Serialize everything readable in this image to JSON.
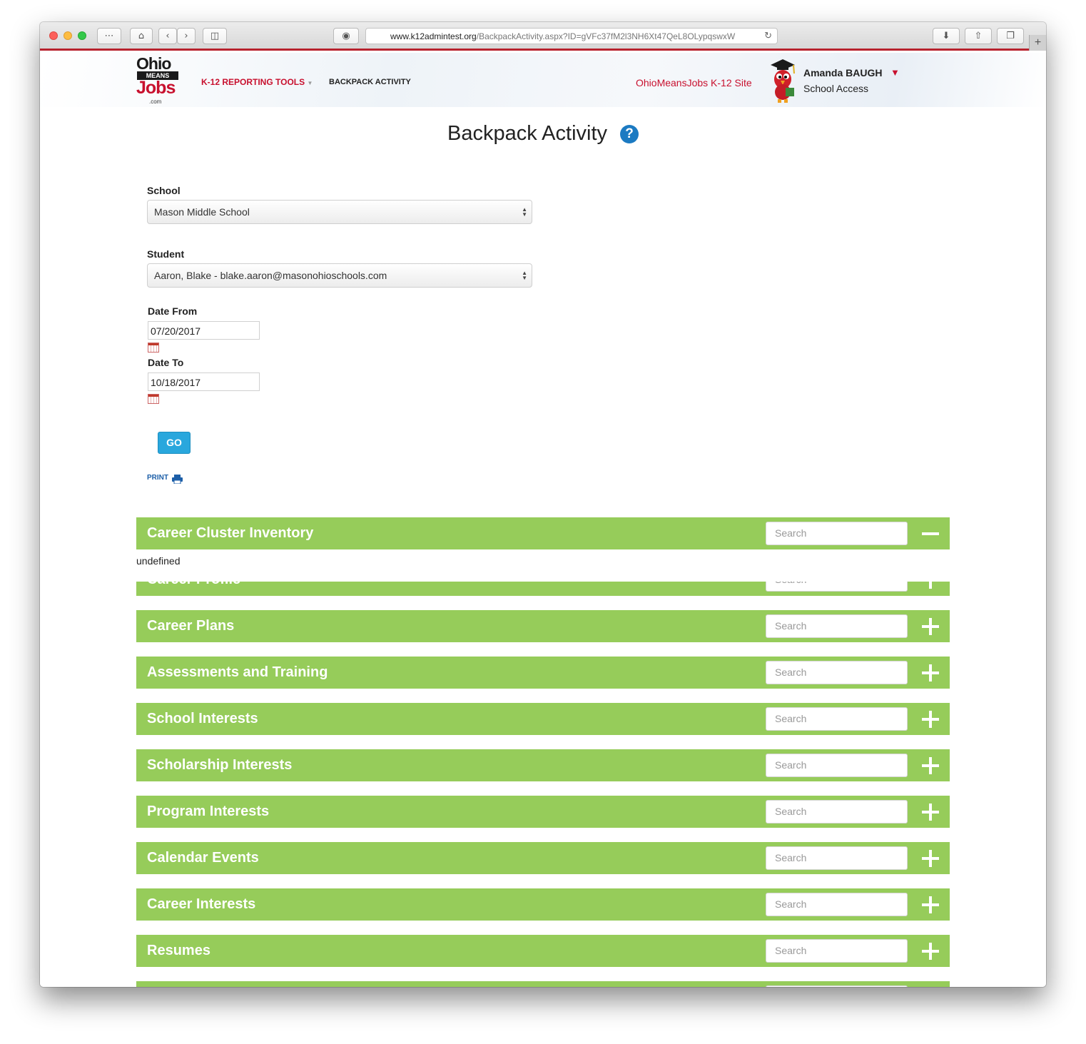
{
  "browser": {
    "url_main": "www.k12admintest.org",
    "url_rest": "/BackpackActivity.aspx?ID=gVFc37fM2l3NH6Xt47QeL8OLypqswxW"
  },
  "header": {
    "logo": {
      "ohio": "Ohio",
      "means": "MEANS",
      "jobs": "Jobs",
      "dotcom": ".com"
    },
    "nav_tools": "K-12 REPORTING TOOLS",
    "nav_backpack": "BACKPACK ACTIVITY",
    "site_link": "OhioMeansJobs K-12 Site",
    "user_name": "Amanda BAUGH",
    "user_role": "School Access"
  },
  "page": {
    "title": "Backpack Activity",
    "help_glyph": "?"
  },
  "form": {
    "school_label": "School",
    "school_value": "Mason Middle School",
    "student_label": "Student",
    "student_value": "Aaron, Blake - blake.aaron@masonohioschools.com",
    "date_from_label": "Date From",
    "date_from_value": "07/20/2017",
    "date_to_label": "Date To",
    "date_to_value": "10/18/2017",
    "go_label": "GO",
    "print_label": "PRINT"
  },
  "sections": {
    "search_placeholder": "Search",
    "undefined_text": "undefined",
    "items": [
      {
        "title": "Career Cluster Inventory",
        "expanded": true
      },
      {
        "title": "Career Profile",
        "expanded": false
      },
      {
        "title": "Career Plans",
        "expanded": false
      },
      {
        "title": "Assessments and Training",
        "expanded": false
      },
      {
        "title": "School Interests",
        "expanded": false
      },
      {
        "title": "Scholarship Interests",
        "expanded": false
      },
      {
        "title": "Program Interests",
        "expanded": false
      },
      {
        "title": "Calendar Events",
        "expanded": false
      },
      {
        "title": "Career Interests",
        "expanded": false
      },
      {
        "title": "Resumes",
        "expanded": false
      },
      {
        "title": "",
        "expanded": false
      }
    ]
  },
  "colors": {
    "section_bar": "#96cc5a",
    "brand_red": "#c8102e",
    "go_button": "#29a7dd",
    "help_icon": "#1b7ac2"
  }
}
